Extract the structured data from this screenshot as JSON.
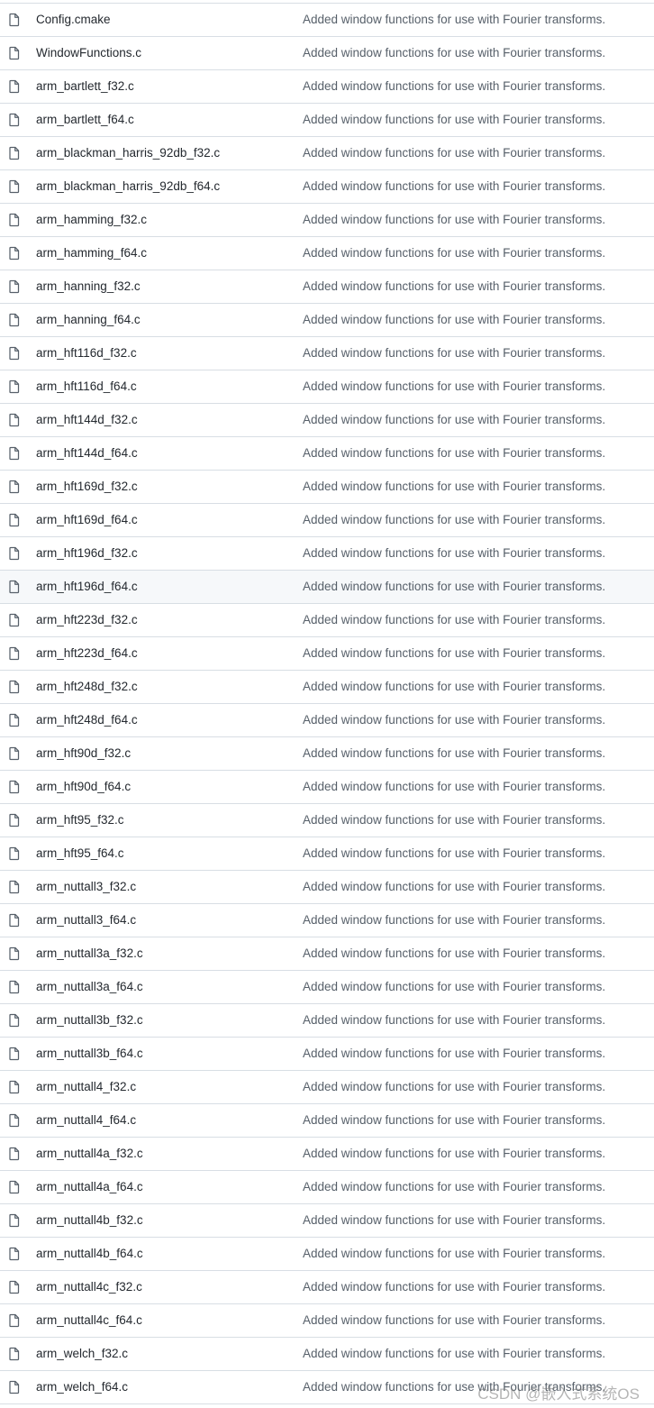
{
  "files": [
    {
      "name": "Config.cmake",
      "message": "Added window functions for use with Fourier transforms."
    },
    {
      "name": "WindowFunctions.c",
      "message": "Added window functions for use with Fourier transforms."
    },
    {
      "name": "arm_bartlett_f32.c",
      "message": "Added window functions for use with Fourier transforms."
    },
    {
      "name": "arm_bartlett_f64.c",
      "message": "Added window functions for use with Fourier transforms."
    },
    {
      "name": "arm_blackman_harris_92db_f32.c",
      "message": "Added window functions for use with Fourier transforms."
    },
    {
      "name": "arm_blackman_harris_92db_f64.c",
      "message": "Added window functions for use with Fourier transforms."
    },
    {
      "name": "arm_hamming_f32.c",
      "message": "Added window functions for use with Fourier transforms."
    },
    {
      "name": "arm_hamming_f64.c",
      "message": "Added window functions for use with Fourier transforms."
    },
    {
      "name": "arm_hanning_f32.c",
      "message": "Added window functions for use with Fourier transforms."
    },
    {
      "name": "arm_hanning_f64.c",
      "message": "Added window functions for use with Fourier transforms."
    },
    {
      "name": "arm_hft116d_f32.c",
      "message": "Added window functions for use with Fourier transforms."
    },
    {
      "name": "arm_hft116d_f64.c",
      "message": "Added window functions for use with Fourier transforms."
    },
    {
      "name": "arm_hft144d_f32.c",
      "message": "Added window functions for use with Fourier transforms."
    },
    {
      "name": "arm_hft144d_f64.c",
      "message": "Added window functions for use with Fourier transforms."
    },
    {
      "name": "arm_hft169d_f32.c",
      "message": "Added window functions for use with Fourier transforms."
    },
    {
      "name": "arm_hft169d_f64.c",
      "message": "Added window functions for use with Fourier transforms."
    },
    {
      "name": "arm_hft196d_f32.c",
      "message": "Added window functions for use with Fourier transforms."
    },
    {
      "name": "arm_hft196d_f64.c",
      "message": "Added window functions for use with Fourier transforms."
    },
    {
      "name": "arm_hft223d_f32.c",
      "message": "Added window functions for use with Fourier transforms."
    },
    {
      "name": "arm_hft223d_f64.c",
      "message": "Added window functions for use with Fourier transforms."
    },
    {
      "name": "arm_hft248d_f32.c",
      "message": "Added window functions for use with Fourier transforms."
    },
    {
      "name": "arm_hft248d_f64.c",
      "message": "Added window functions for use with Fourier transforms."
    },
    {
      "name": "arm_hft90d_f32.c",
      "message": "Added window functions for use with Fourier transforms."
    },
    {
      "name": "arm_hft90d_f64.c",
      "message": "Added window functions for use with Fourier transforms."
    },
    {
      "name": "arm_hft95_f32.c",
      "message": "Added window functions for use with Fourier transforms."
    },
    {
      "name": "arm_hft95_f64.c",
      "message": "Added window functions for use with Fourier transforms."
    },
    {
      "name": "arm_nuttall3_f32.c",
      "message": "Added window functions for use with Fourier transforms."
    },
    {
      "name": "arm_nuttall3_f64.c",
      "message": "Added window functions for use with Fourier transforms."
    },
    {
      "name": "arm_nuttall3a_f32.c",
      "message": "Added window functions for use with Fourier transforms."
    },
    {
      "name": "arm_nuttall3a_f64.c",
      "message": "Added window functions for use with Fourier transforms."
    },
    {
      "name": "arm_nuttall3b_f32.c",
      "message": "Added window functions for use with Fourier transforms."
    },
    {
      "name": "arm_nuttall3b_f64.c",
      "message": "Added window functions for use with Fourier transforms."
    },
    {
      "name": "arm_nuttall4_f32.c",
      "message": "Added window functions for use with Fourier transforms."
    },
    {
      "name": "arm_nuttall4_f64.c",
      "message": "Added window functions for use with Fourier transforms."
    },
    {
      "name": "arm_nuttall4a_f32.c",
      "message": "Added window functions for use with Fourier transforms."
    },
    {
      "name": "arm_nuttall4a_f64.c",
      "message": "Added window functions for use with Fourier transforms."
    },
    {
      "name": "arm_nuttall4b_f32.c",
      "message": "Added window functions for use with Fourier transforms."
    },
    {
      "name": "arm_nuttall4b_f64.c",
      "message": "Added window functions for use with Fourier transforms."
    },
    {
      "name": "arm_nuttall4c_f32.c",
      "message": "Added window functions for use with Fourier transforms."
    },
    {
      "name": "arm_nuttall4c_f64.c",
      "message": "Added window functions for use with Fourier transforms."
    },
    {
      "name": "arm_welch_f32.c",
      "message": "Added window functions for use with Fourier transforms."
    },
    {
      "name": "arm_welch_f64.c",
      "message": "Added window functions for use with Fourier transforms."
    }
  ],
  "hovered_row": "arm_hft196d_f64.c",
  "icons": {
    "file": "file-icon"
  },
  "colors": {
    "file_name": "#24292f",
    "commit_message": "#57606a",
    "divider": "#d8dee4",
    "hover_background": "#f6f8fa",
    "icon": "#57606a"
  },
  "watermark": "CSDN @嵌入式系统OS"
}
